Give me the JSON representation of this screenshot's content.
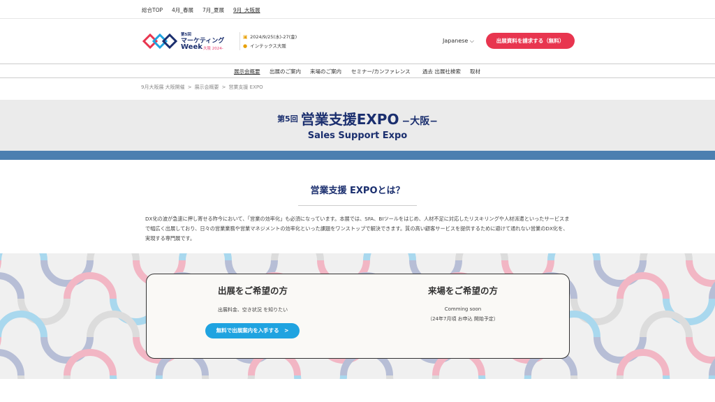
{
  "topnav": {
    "items": [
      "総合TOP",
      "4月_春展",
      "7月_夏展",
      "9月_大阪展"
    ]
  },
  "header": {
    "logo": {
      "small": "第5回",
      "main": "マーケティング",
      "week": "Week",
      "sub": "-大阪 2024-"
    },
    "date": "2024/9/25(水)-27(金)",
    "venue": "インテックス大阪",
    "language": "Japanese ⌵",
    "cta_label": "出展資料を請求する（無料）"
  },
  "mainnav": {
    "items": [
      "展示会概要",
      "出展のご案内",
      "来場のご案内",
      "セミナー/カンファレンス",
      "過去 出展社検索",
      "取材"
    ]
  },
  "breadcrumb": [
    "9月大阪展 大阪開催",
    "展示会概要",
    "営業支援 EXPO"
  ],
  "hero": {
    "nth": "第5回",
    "title": "営業支援EXPO",
    "suffix": "−大阪−",
    "en_title": "Sales Support Expo"
  },
  "about": {
    "title": "営業支援 EXPOとは？",
    "body": "DX化の波が急速に押し寄せる昨今において、「営業の効率化」も必須になっています。本展では、SFA、BIツールをはじめ、人材不足に対応したリスキリングや人材派遣といったサービスまで幅広く出展しており、日々の営業業務や営業マネジメントの効率化といった課題をワンストップで解決できます。質の高い顧客サービスを提供するために避けて通れない営業のDX化を、実現する専門展です。"
  },
  "exhibit": {
    "title": "出展をご希望の方",
    "text": "出展料金、空き状況 を知りたい",
    "button": "無料で出展案内を入手する　>"
  },
  "visit": {
    "title": "来場をご希望の方",
    "line1": "Comming soon",
    "line2": "（24年7月頃 お申込 開始予定）"
  },
  "colors": {
    "brand_navy": "#1a2e6e",
    "cta_red": "#e8354f",
    "button_blue": "#1fa3e0",
    "stripe_blue": "#4c7fb0"
  }
}
